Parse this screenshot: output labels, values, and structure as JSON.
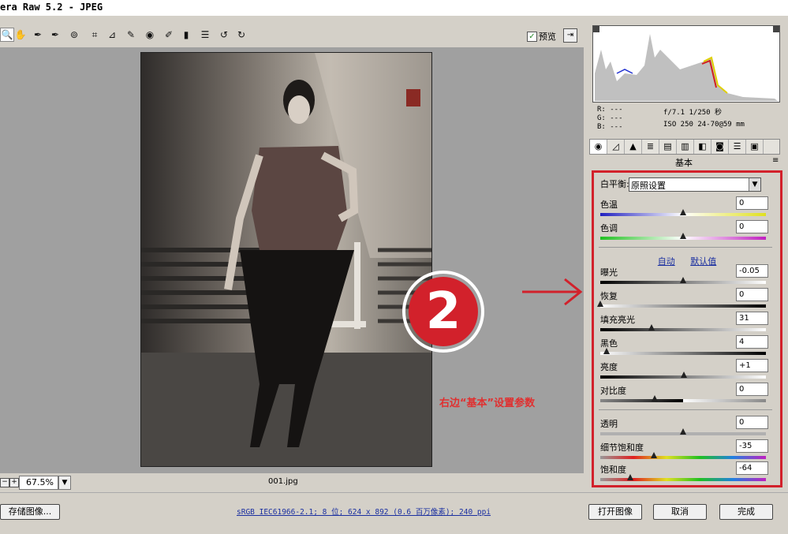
{
  "window": {
    "title": "era Raw 5.2 -  JPEG"
  },
  "toolbar": {
    "tools": [
      "zoom-icon",
      "hand-icon",
      "white-balance-icon",
      "color-sampler-icon",
      "target-adjust-icon",
      "crop-icon",
      "straighten-icon",
      "retouch-icon",
      "red-eye-icon",
      "adjustment-brush-icon",
      "graduated-filter-icon",
      "preferences-icon",
      "rotate-left-icon",
      "rotate-right-icon"
    ],
    "preview_label": "预览",
    "preview_checked": true
  },
  "status": {
    "zoom": "67.5%",
    "filename": "001.jpg"
  },
  "bottom": {
    "save_label": "存储图像...",
    "info": "sRGB IEC61966-2.1; 8 位; 624 x 892 (0.6 百万像素); 240 ppi",
    "open_label": "打开图像",
    "cancel_label": "取消",
    "done_label": "完成"
  },
  "readout": {
    "r": "R:  ---",
    "g": "G:  ---",
    "b": "B:  ---",
    "aperture_shutter": "f/7.1  1/250 秒",
    "iso_lens": "ISO 250  24-70@59 mm"
  },
  "panel": {
    "title": "基本",
    "wb_label": "白平衡:",
    "wb_value": "原照设置",
    "auto_label": "自动",
    "default_label": "默认值",
    "sliders": [
      {
        "key": "temp",
        "label": "色温",
        "value": "0",
        "pos": 0.5
      },
      {
        "key": "tint",
        "label": "色调",
        "value": "0",
        "pos": 0.5
      },
      {
        "key": "exposure",
        "label": "曝光",
        "value": "-0.05",
        "pos": 0.5
      },
      {
        "key": "recovery",
        "label": "恢复",
        "value": "0",
        "pos": 0.0
      },
      {
        "key": "fill",
        "label": "填充亮光",
        "value": "31",
        "pos": 0.31
      },
      {
        "key": "blacks",
        "label": "黑色",
        "value": "4",
        "pos": 0.04
      },
      {
        "key": "brightness",
        "label": "亮度",
        "value": "+1",
        "pos": 0.505
      },
      {
        "key": "contrast",
        "label": "对比度",
        "value": "0",
        "pos": 0.33
      },
      {
        "key": "clarity",
        "label": "透明",
        "value": "0",
        "pos": 0.5
      },
      {
        "key": "vibrance",
        "label": "细节饱和度",
        "value": "-35",
        "pos": 0.325
      },
      {
        "key": "saturation",
        "label": "饱和度",
        "value": "-64",
        "pos": 0.18
      }
    ]
  },
  "annotation": {
    "number": "2",
    "text": "右边“基本”设置参数"
  },
  "colors": {
    "highlight_red": "#d2212b"
  }
}
